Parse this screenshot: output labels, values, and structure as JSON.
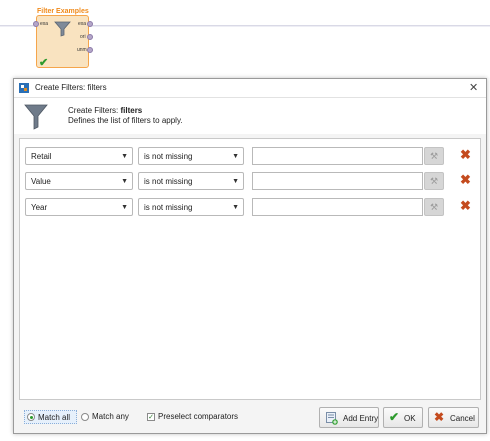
{
  "canvas": {
    "operator": {
      "title": "Filter Examples",
      "input_port": "exa",
      "output_ports": [
        "exa",
        "ori",
        "unm"
      ]
    }
  },
  "dialog": {
    "title": "Create Filters: filters",
    "header": {
      "prefix": "Create Filters: ",
      "name": "filters",
      "description": "Defines the list of filters to apply."
    },
    "filters": [
      {
        "attribute": "Retail",
        "comparator": "is not missing",
        "value": ""
      },
      {
        "attribute": "Value",
        "comparator": "is not missing",
        "value": ""
      },
      {
        "attribute": "Year",
        "comparator": "is not missing",
        "value": ""
      }
    ],
    "footer": {
      "match_all": "Match all",
      "match_any": "Match any",
      "match_selected": "all",
      "preselect": "Preselect comparators",
      "preselect_checked": true,
      "add_entry": "Add Entry",
      "ok": "OK",
      "cancel": "Cancel"
    }
  },
  "colors": {
    "operator_title": "#f08a1a",
    "operator_fill": "#f9e3c0",
    "delete_icon": "#c44b1e",
    "ok_check": "#2d9a2d"
  },
  "icons": {
    "funnel": "funnel-icon",
    "wand": "magic-wand-icon",
    "delete": "delete-x-icon",
    "close": "close-icon",
    "add_entry": "add-entry-icon",
    "ok": "check-icon",
    "cancel": "cancel-x-icon"
  }
}
